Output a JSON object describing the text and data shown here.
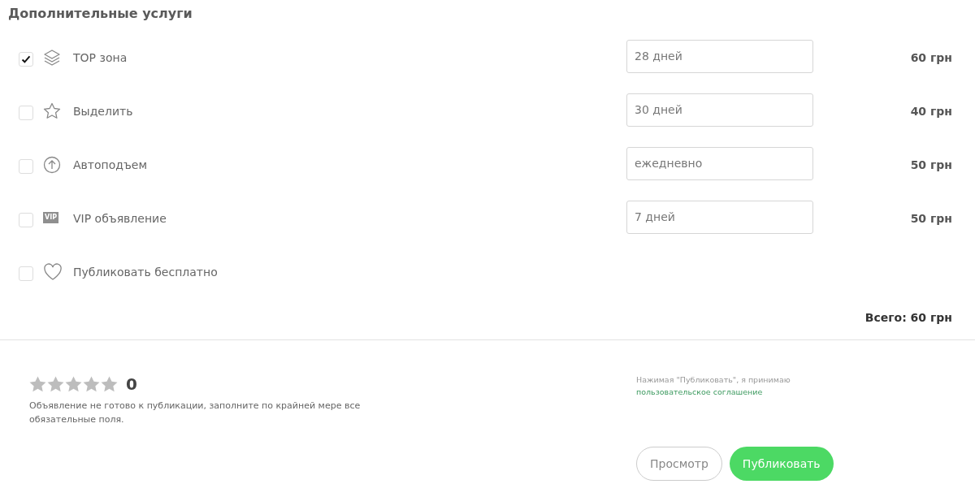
{
  "title": "Дополнительные услуги",
  "services": [
    {
      "kind": "layers",
      "label": "TOP зона",
      "checked": true,
      "duration": "28 дней",
      "price": "60 грн"
    },
    {
      "kind": "star",
      "label": "Выделить",
      "checked": false,
      "duration": "30 дней",
      "price": "40 грн"
    },
    {
      "kind": "arrow-up",
      "label": "Автоподъем",
      "checked": false,
      "duration": "ежедневно",
      "price": "50 грн"
    },
    {
      "kind": "vip",
      "badge": "VIP",
      "label": "VIP объявление",
      "checked": false,
      "duration": "7 дней",
      "price": "50 грн"
    },
    {
      "kind": "heart",
      "label": "Публиковать бесплатно",
      "checked": false
    }
  ],
  "total": "Всего: 60 грн",
  "rating": {
    "stars": 0,
    "score": "0"
  },
  "warning": "Объявление не готово к публикации, заполните по крайней мере все обязательные поля.",
  "consent": {
    "text": "Нажимая \"Публиковать\", я принимаю",
    "link": "пользовательское соглашение"
  },
  "buttons": [
    {
      "kind": "outline",
      "label": "Просмотр"
    },
    {
      "kind": "primary",
      "label": "Публиковать"
    }
  ]
}
